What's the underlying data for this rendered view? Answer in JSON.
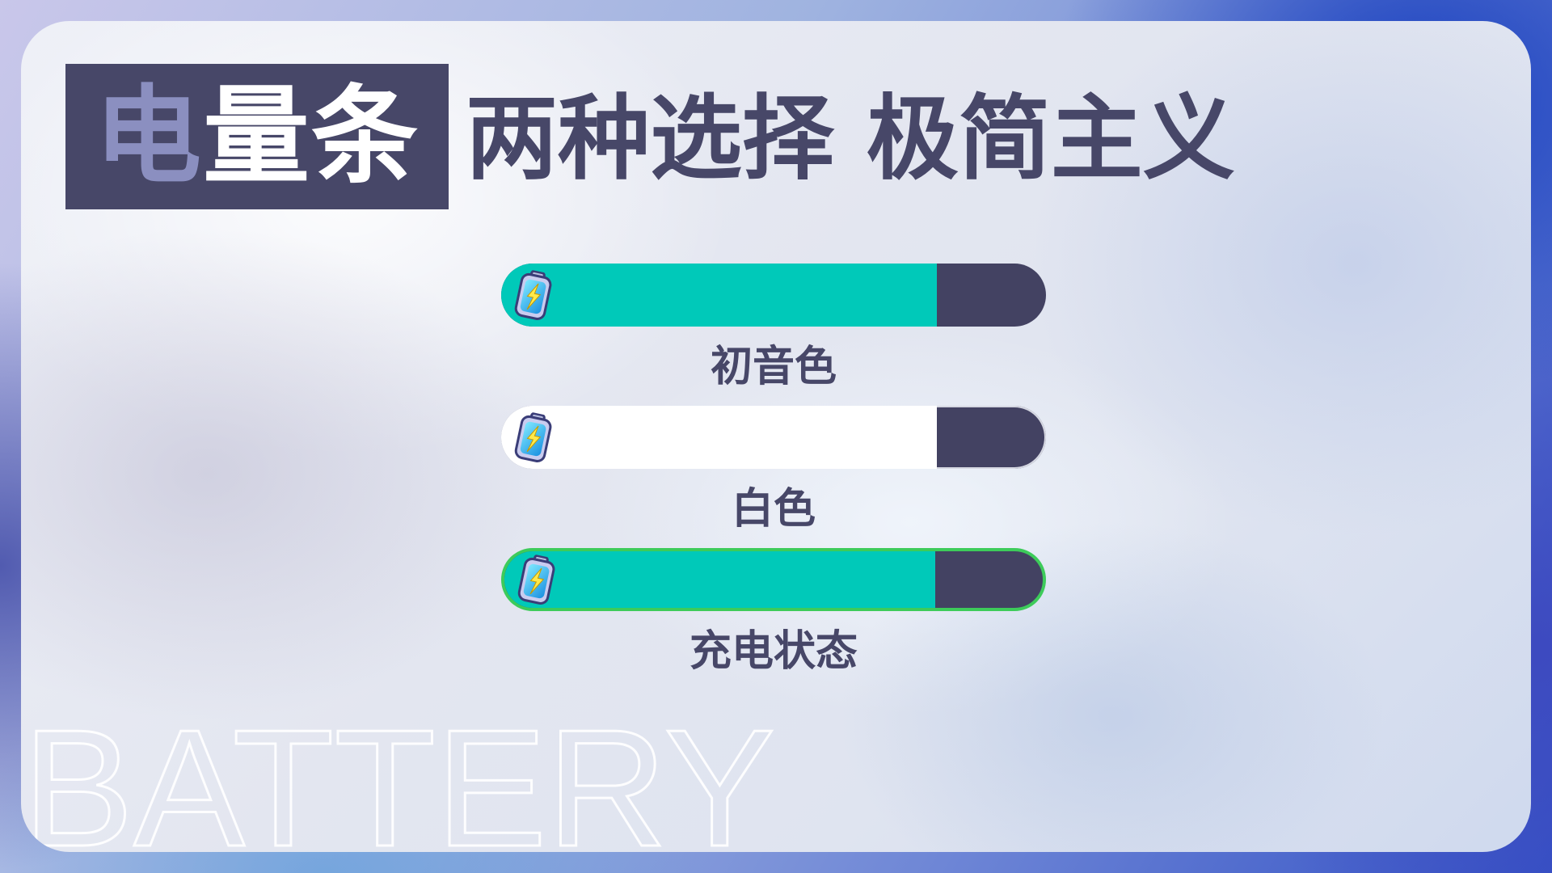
{
  "title": {
    "highlight": "电",
    "main_rest": "量条",
    "subtitle": "两种选择 极简主义"
  },
  "bars": [
    {
      "label": "初音色",
      "fill_fraction": 0.8,
      "fill_color": "#00c9b9",
      "style": "plain"
    },
    {
      "label": "白色",
      "fill_fraction": 0.8,
      "fill_color": "#ffffff",
      "style": "white"
    },
    {
      "label": "充电状态",
      "fill_fraction": 0.8,
      "fill_color": "#00c9b9",
      "style": "charging"
    }
  ],
  "icons": {
    "battery": "battery-charging-icon"
  },
  "colors": {
    "dark": "#474768",
    "accent": "#8b8fc0",
    "miku": "#00c9b9",
    "charging_border": "#3dcb5a"
  },
  "watermark": "BATTERY"
}
